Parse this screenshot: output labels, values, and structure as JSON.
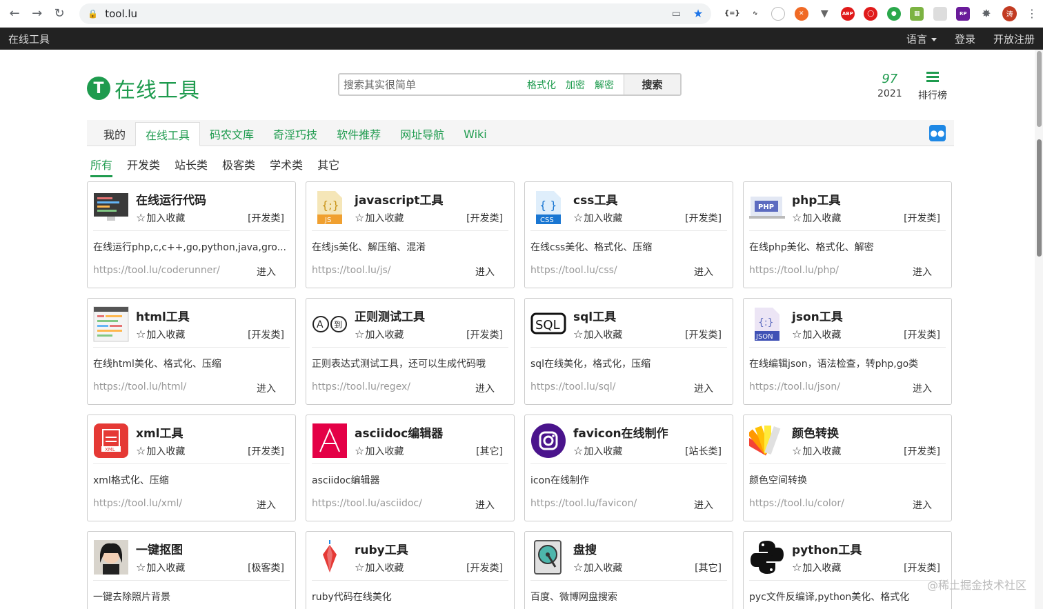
{
  "browser": {
    "url": "tool.lu",
    "profile_initial": "涛"
  },
  "topbar": {
    "brand": "在线工具",
    "language": "语言",
    "login": "登录",
    "register": "开放注册"
  },
  "header": {
    "logo_letter": "T",
    "logo_text": "在线工具",
    "search_placeholder": "搜索其实很简单",
    "search_tags": [
      "格式化",
      "加密",
      "解密"
    ],
    "search_button": "搜索",
    "stat_num": "97",
    "stat_year": "2021",
    "ranking": "排行榜"
  },
  "tabs": [
    "我的",
    "在线工具",
    "码农文库",
    "奇淫巧技",
    "软件推荐",
    "网址导航",
    "Wiki"
  ],
  "categories": [
    "所有",
    "开发类",
    "站长类",
    "极客类",
    "学术类",
    "其它"
  ],
  "fav_label": "加入收藏",
  "enter_label": "进入",
  "cards": [
    {
      "title": "在线运行代码",
      "cat": "[开发类]",
      "desc": "在线运行php,c,c++,go,python,java,gro...",
      "link": "https://tool.lu/coderunner/",
      "icon": "monitor-icon"
    },
    {
      "title": "javascript工具",
      "cat": "[开发类]",
      "desc": "在线js美化、解压缩、混淆",
      "link": "https://tool.lu/js/",
      "icon": "js-file-icon"
    },
    {
      "title": "css工具",
      "cat": "[开发类]",
      "desc": "在线css美化、格式化、压缩",
      "link": "https://tool.lu/css/",
      "icon": "css-file-icon"
    },
    {
      "title": "php工具",
      "cat": "[开发类]",
      "desc": "在线php美化、格式化、解密",
      "link": "https://tool.lu/php/",
      "icon": "php-icon"
    },
    {
      "title": "html工具",
      "cat": "[开发类]",
      "desc": "在线html美化、格式化、压缩",
      "link": "https://tool.lu/html/",
      "icon": "html-code-icon"
    },
    {
      "title": "正则测试工具",
      "cat": "[开发类]",
      "desc": "正则表达式测试工具，还可以生成代码哦",
      "link": "https://tool.lu/regex/",
      "icon": "regex-icon"
    },
    {
      "title": "sql工具",
      "cat": "[开发类]",
      "desc": "sql在线美化，格式化，压缩",
      "link": "https://tool.lu/sql/",
      "icon": "sql-icon"
    },
    {
      "title": "json工具",
      "cat": "[开发类]",
      "desc": "在线编辑json，语法检查，转php,go类",
      "link": "https://tool.lu/json/",
      "icon": "json-file-icon"
    },
    {
      "title": "xml工具",
      "cat": "[开发类]",
      "desc": "xml格式化、压缩",
      "link": "https://tool.lu/xml/",
      "icon": "xml-file-icon"
    },
    {
      "title": "asciidoc编辑器",
      "cat": "[其它]",
      "desc": "asciidoc编辑器",
      "link": "https://tool.lu/asciidoc/",
      "icon": "asciidoc-icon"
    },
    {
      "title": "favicon在线制作",
      "cat": "[站长类]",
      "desc": "icon在线制作",
      "link": "https://tool.lu/favicon/",
      "icon": "favicon-icon"
    },
    {
      "title": "颜色转换",
      "cat": "[开发类]",
      "desc": "颜色空间转换",
      "link": "https://tool.lu/color/",
      "icon": "color-palette-icon"
    },
    {
      "title": "一键抠图",
      "cat": "[极客类]",
      "desc": "一键去除照片背景",
      "link": "",
      "icon": "portrait-icon"
    },
    {
      "title": "ruby工具",
      "cat": "[开发类]",
      "desc": "ruby代码在线美化",
      "link": "",
      "icon": "ruby-gem-icon"
    },
    {
      "title": "盘搜",
      "cat": "[其它]",
      "desc": "百度、微博网盘搜索",
      "link": "",
      "icon": "disk-search-icon"
    },
    {
      "title": "python工具",
      "cat": "[开发类]",
      "desc": "pyc文件反编译,python美化、格式化",
      "link": "",
      "icon": "python-icon"
    }
  ],
  "watermark": "@稀土掘金技术社区"
}
